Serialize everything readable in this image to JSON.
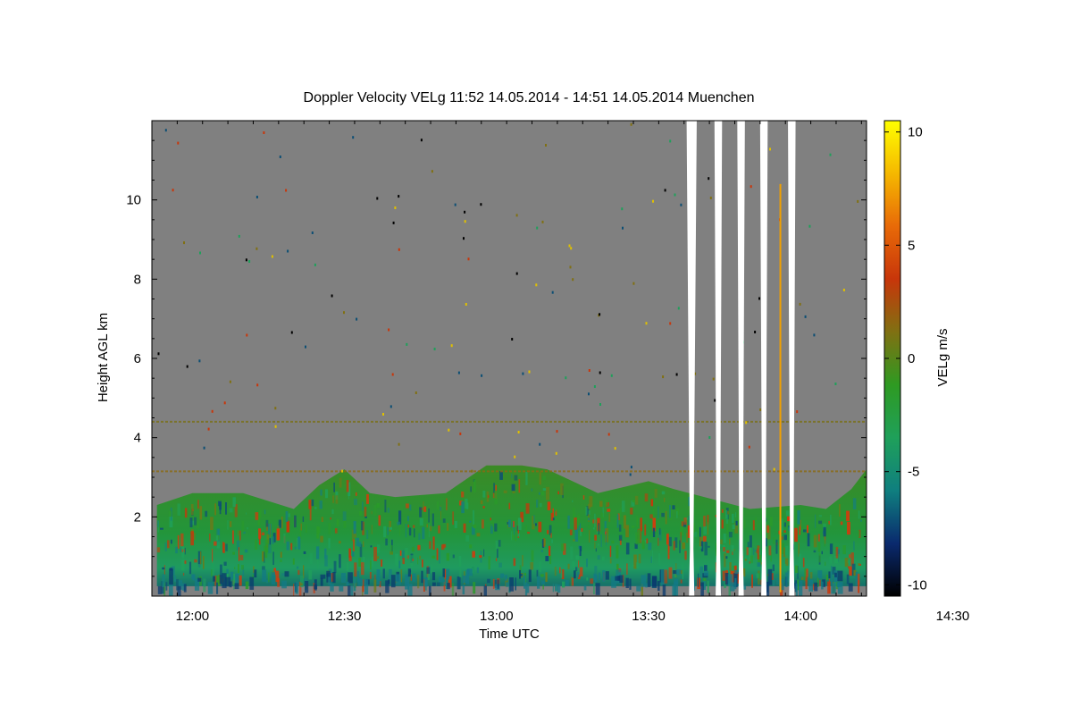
{
  "chart_data": {
    "type": "heatmap",
    "title": "Doppler Velocity VELg   11:52 14.05.2014 - 14:51 14.05.2014 Muenchen",
    "xlabel": "Time UTC",
    "ylabel": "Height AGL km",
    "x_tick_labels": [
      "12:00",
      "12:30",
      "13:00",
      "13:30",
      "14:00",
      "14:30"
    ],
    "x_tick_values_min": [
      720,
      750,
      780,
      810,
      840,
      870
    ],
    "xlim_min": [
      712,
      853
    ],
    "xlim_label": [
      "11:52",
      "14:51"
    ],
    "y_tick_values": [
      2,
      4,
      6,
      8,
      10
    ],
    "ylim": [
      0,
      12
    ],
    "colorbar": {
      "label": "VELg m/s",
      "range": [
        -10.5,
        10.5
      ],
      "tick_values": [
        -10,
        -5,
        0,
        5,
        10
      ],
      "colors": [
        "#000000",
        "#0a2a6e",
        "#0f7f7f",
        "#1fa05a",
        "#2e9a22",
        "#807012",
        "#c8360a",
        "#e86a08",
        "#f5b800",
        "#ffff00"
      ]
    },
    "background_color": "#808080",
    "boundary_layer_top_km": [
      {
        "t": 713,
        "h": 2.3
      },
      {
        "t": 720,
        "h": 2.6
      },
      {
        "t": 730,
        "h": 2.6
      },
      {
        "t": 740,
        "h": 2.2
      },
      {
        "t": 745,
        "h": 2.8
      },
      {
        "t": 750,
        "h": 3.2
      },
      {
        "t": 755,
        "h": 2.6
      },
      {
        "t": 760,
        "h": 2.5
      },
      {
        "t": 770,
        "h": 2.6
      },
      {
        "t": 778,
        "h": 3.3
      },
      {
        "t": 785,
        "h": 3.3
      },
      {
        "t": 790,
        "h": 3.2
      },
      {
        "t": 800,
        "h": 2.6
      },
      {
        "t": 810,
        "h": 2.9
      },
      {
        "t": 815,
        "h": 2.7
      },
      {
        "t": 830,
        "h": 2.2
      },
      {
        "t": 840,
        "h": 2.3
      },
      {
        "t": 845,
        "h": 2.2
      },
      {
        "t": 850,
        "h": 2.7
      },
      {
        "t": 853,
        "h": 3.2
      }
    ],
    "data_gaps_min": [
      [
        817.5,
        819.5
      ],
      [
        823,
        824.5
      ],
      [
        827.5,
        829
      ],
      [
        832,
        833.5
      ],
      [
        837.5,
        839
      ]
    ]
  }
}
